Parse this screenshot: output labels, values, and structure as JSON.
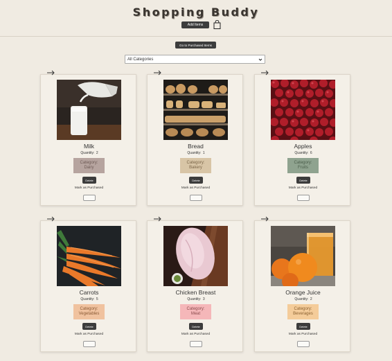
{
  "header": {
    "title": "Shopping Buddy",
    "add_button": "Add Items",
    "purchased_button": "Go to Purchased Items"
  },
  "filter": {
    "selected": "All Categories"
  },
  "card_common": {
    "delete_label": "Delete",
    "mark_label": "Mark as Purchased",
    "quantity_prefix": "Quantity:",
    "category_prefix": "Category:"
  },
  "items": [
    {
      "name": "Milk",
      "quantity": "2",
      "category": "Dairy",
      "badge_color": "#b6a49f",
      "badge_text": "#6d5a55",
      "icon": "milk-photo"
    },
    {
      "name": "Bread",
      "quantity": "1",
      "category": "Bakery",
      "badge_color": "#d8c5a6",
      "badge_text": "#7a6548",
      "icon": "bread-photo"
    },
    {
      "name": "Apples",
      "quantity": "6",
      "category": "Fruits",
      "badge_color": "#8fa38f",
      "badge_text": "#4a5d4a",
      "icon": "apples-photo"
    },
    {
      "name": "Carrots",
      "quantity": "5",
      "category": "Vegetables",
      "badge_color": "#f0c29f",
      "badge_text": "#8a5a35",
      "icon": "carrots-photo"
    },
    {
      "name": "Chicken Breast",
      "quantity": "3",
      "category": "Meat",
      "badge_color": "#f5b7b9",
      "badge_text": "#8a4a4c",
      "icon": "chicken-photo"
    },
    {
      "name": "Orange Juice",
      "quantity": "2",
      "category": "Beverages",
      "badge_color": "#f4cc9a",
      "badge_text": "#8a6030",
      "icon": "orange-juice-photo"
    }
  ]
}
